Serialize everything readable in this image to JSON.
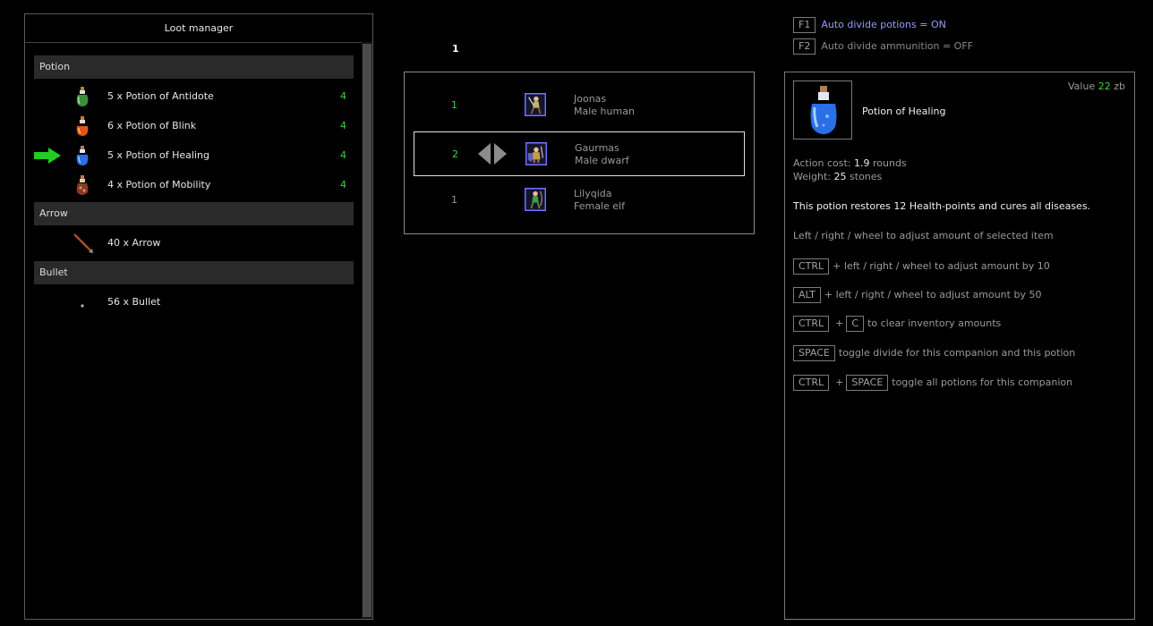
{
  "loot_manager": {
    "title": "Loot manager",
    "categories": [
      {
        "name": "Potion",
        "items": [
          {
            "label": "5 x Potion of Antidote",
            "count": "4",
            "icon": "green-potion-icon"
          },
          {
            "label": "6 x Potion of Blink",
            "count": "4",
            "icon": "orange-potion-icon"
          },
          {
            "label": "5 x Potion of Healing",
            "count": "4",
            "icon": "blue-potion-icon",
            "selected": true
          },
          {
            "label": "4 x Potion of Mobility",
            "count": "4",
            "icon": "red-potion-icon"
          }
        ]
      },
      {
        "name": "Arrow",
        "items": [
          {
            "label": "40 x Arrow",
            "count": "",
            "icon": "arrow-icon"
          }
        ]
      },
      {
        "name": "Bullet",
        "items": [
          {
            "label": "56 x Bullet",
            "count": "",
            "icon": "bullet-icon"
          }
        ]
      }
    ]
  },
  "companions": {
    "remaining": "1",
    "list": [
      {
        "amount": "1",
        "name": "Joonas",
        "race": "Male human",
        "amount_color": "#3fd23f"
      },
      {
        "amount": "2",
        "name": "Gaurmas",
        "race": "Male dwarf",
        "amount_color": "#3fd23f",
        "selected": true
      },
      {
        "amount": "1",
        "name": "Lilyqida",
        "race": "Female elf",
        "amount_color": "#9a9a9a"
      }
    ]
  },
  "toggles": {
    "f1_key": "F1",
    "f1_text": "Auto divide potions = ON",
    "f2_key": "F2",
    "f2_text": "Auto divide ammunition = OFF"
  },
  "item": {
    "name": "Potion of Healing",
    "value_label": "Value",
    "value": "22",
    "value_unit": "zb",
    "action_cost_label": "Action cost:",
    "action_cost": "1.9",
    "action_cost_unit": "rounds",
    "weight_label": "Weight:",
    "weight": "25",
    "weight_unit": "stones",
    "description": "This potion restores 12 Health-points and cures all diseases."
  },
  "hints": {
    "adjust": "Left / right / wheel to adjust amount of selected item",
    "ctrl_key": "CTRL",
    "ctrl_text": "+ left / right / wheel to adjust amount by 10",
    "alt_key": "ALT",
    "alt_text": "+ left / right / wheel to adjust amount by 50",
    "clear_key1": "CTRL",
    "clear_plus": "+",
    "clear_key2": "C",
    "clear_text": "to clear inventory amounts",
    "space_key": "SPACE",
    "space_text": "toggle divide for this companion and this potion",
    "all_key1": "CTRL",
    "all_plus": "+",
    "all_key2": "SPACE",
    "all_text": "toggle all potions for this companion"
  },
  "colors": {
    "accent_green": "#3fd23f",
    "toggle_on": "#9a9aff",
    "muted": "#9a9a9a"
  }
}
